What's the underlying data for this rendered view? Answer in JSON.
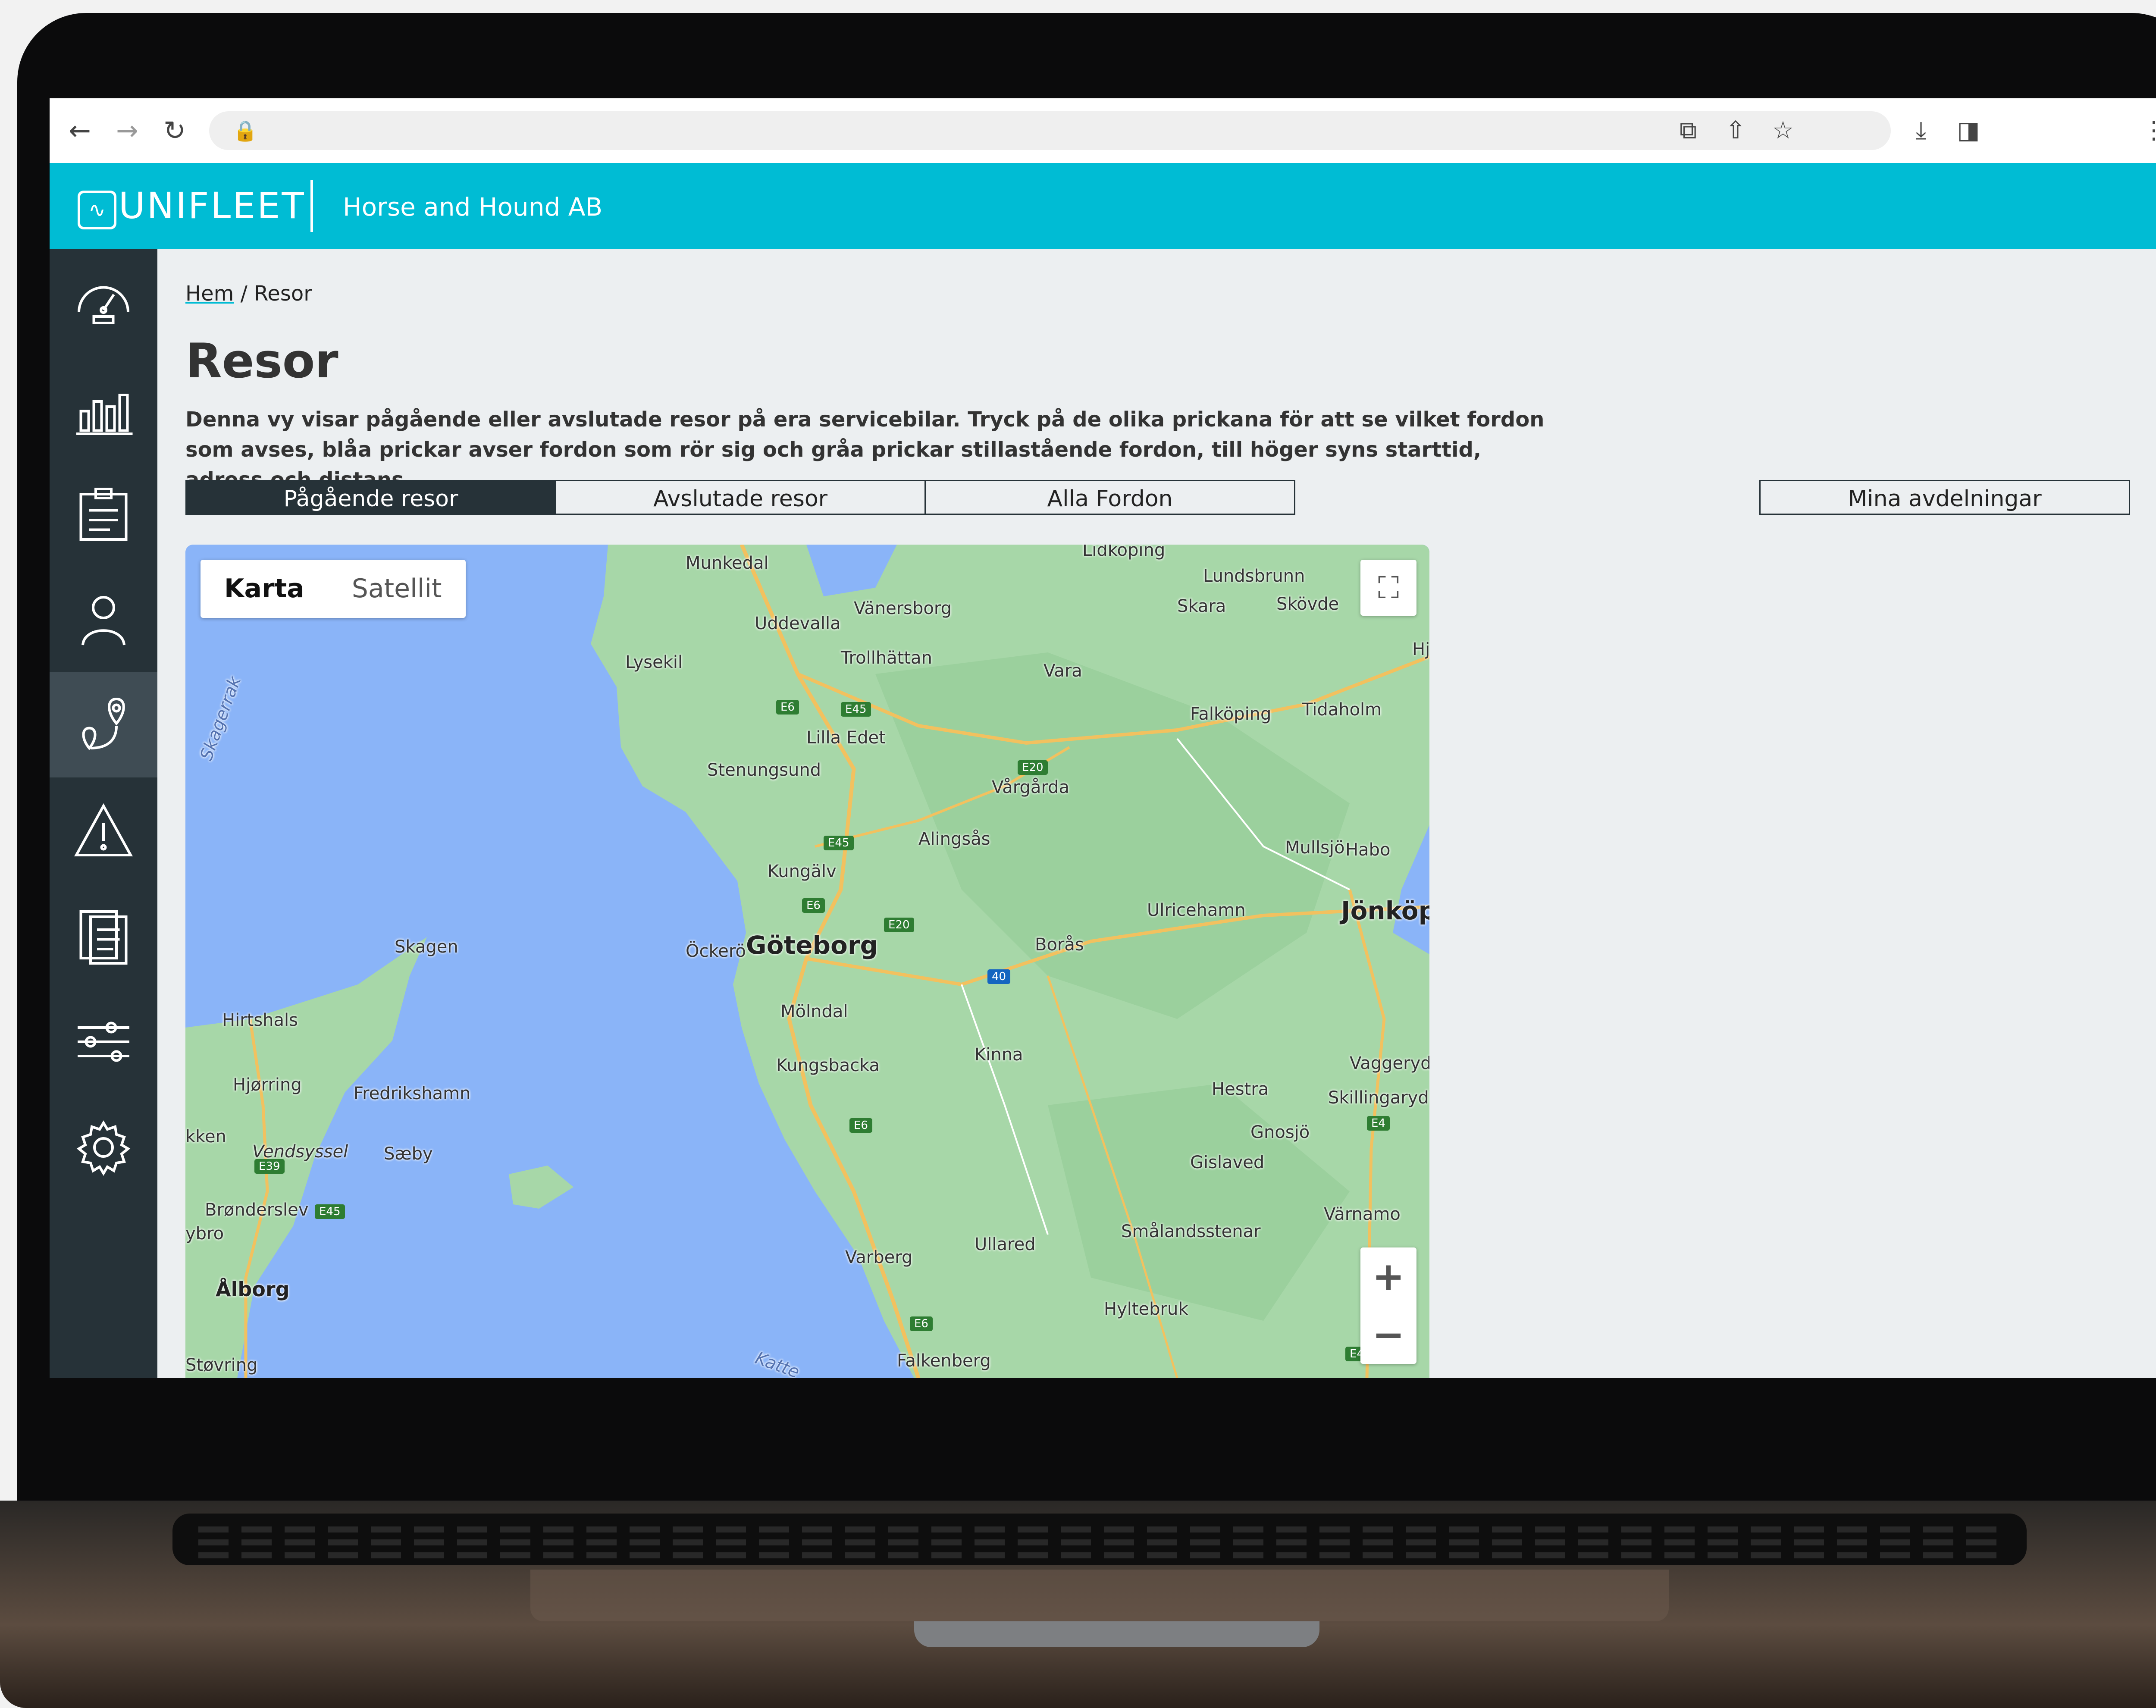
{
  "browser": {
    "back_icon": "arrow-left-icon",
    "forward_icon": "arrow-right-icon",
    "reload_icon": "reload-icon",
    "lock_icon": "lock-icon",
    "tool_icons": [
      "translate-icon",
      "share-icon",
      "star-icon",
      "download-icon",
      "sidepanel-icon",
      "more-icon"
    ]
  },
  "header": {
    "brand": "UNIFLEET",
    "company": "Horse and Hound AB",
    "color": "#00bcd4"
  },
  "sidebar": {
    "items": [
      {
        "icon": "speedometer-icon"
      },
      {
        "icon": "bar-chart-icon"
      },
      {
        "icon": "clipboard-list-icon"
      },
      {
        "icon": "driver-icon"
      },
      {
        "icon": "route-pin-icon",
        "active": true
      },
      {
        "icon": "warning-icon"
      },
      {
        "icon": "document-icon"
      },
      {
        "icon": "sliders-icon"
      },
      {
        "icon": "gear-icon"
      }
    ],
    "color": "#263238"
  },
  "breadcrumb": {
    "home": "Hem",
    "sep": "/",
    "current": "Resor"
  },
  "page": {
    "title": "Resor",
    "description": "Denna vy visar pågående eller avslutade resor på era servicebilar. Tryck på de olika prickana för att se vilket fordon som avses, blåa prickar avser fordon som rör sig och gråa prickar stillastående fordon, till höger syns starttid, adress och distans."
  },
  "tabs": [
    {
      "label": "Pågående resor",
      "active": true
    },
    {
      "label": "Avslutade resor"
    },
    {
      "label": "Alla Fordon"
    }
  ],
  "departments_button": "Mina avdelningar",
  "map": {
    "type_options": [
      "Karta",
      "Satellit"
    ],
    "selected_type": "Karta",
    "zoom_in": "+",
    "zoom_out": "−",
    "places": {
      "lidkoping": "Lidköping",
      "munkedal": "Munkedal",
      "lundsbrunn": "Lundsbrunn",
      "vanersborg": "Vänersborg",
      "skara": "Skara",
      "skovde": "Skövde",
      "uddevalla": "Uddevalla",
      "trollhattan": "Trollhättan",
      "lysekil": "Lysekil",
      "vara": "Vara",
      "hj": "Hj",
      "falkoping": "Falköping",
      "tidaholm": "Tidaholm",
      "skagerrak": "Skagerrak",
      "lilla_edet": "Lilla Edet",
      "stenungsund": "Stenungsund",
      "vargarda": "Vårgårda",
      "alingsas": "Alingsås",
      "mullsjo": "Mullsjö",
      "habo": "Habo",
      "kungalv": "Kungälv",
      "ulricehamn": "Ulricehamn",
      "jonkoping": "Jönköpin",
      "skagen": "Skagen",
      "ockero": "Öckerö",
      "goteborg": "Göteborg",
      "boras": "Borås",
      "hirtshals": "Hirtshals",
      "molndal": "Mölndal",
      "kinna": "Kinna",
      "vaggeryd": "Vaggeryd",
      "hjorring": "Hjørring",
      "fredrikshamn": "Fredrikshamn",
      "kungsbacka": "Kungsbacka",
      "hestra": "Hestra",
      "skillingaryd": "Skillingaryd",
      "lokken": "kken",
      "vendsyssel": "Vendsyssel",
      "saeby": "Sæby",
      "gnosjo": "Gnosjö",
      "gislaved": "Gislaved",
      "bronderslev": "Brønderslev",
      "varnamo": "Värnamo",
      "smalandsstenar": "Smålandsstenar",
      "ybro": "ybro",
      "ullared": "Ullared",
      "varberg": "Varberg",
      "aalborg": "Ålborg",
      "hyltebruk": "Hyltebruk",
      "storvring": "Støvring",
      "kattegat": "Katte",
      "falkenberg": "Falkenberg"
    },
    "roads": {
      "e6a": "E6",
      "e45a": "E45",
      "e20a": "E20",
      "e45b": "E45",
      "e6b": "E6",
      "e20b": "E20",
      "r40": "40",
      "e39": "E39",
      "e45c": "E45",
      "e6c": "E6",
      "e4": "E4",
      "e6d": "E6",
      "e4b": "E4"
    }
  }
}
